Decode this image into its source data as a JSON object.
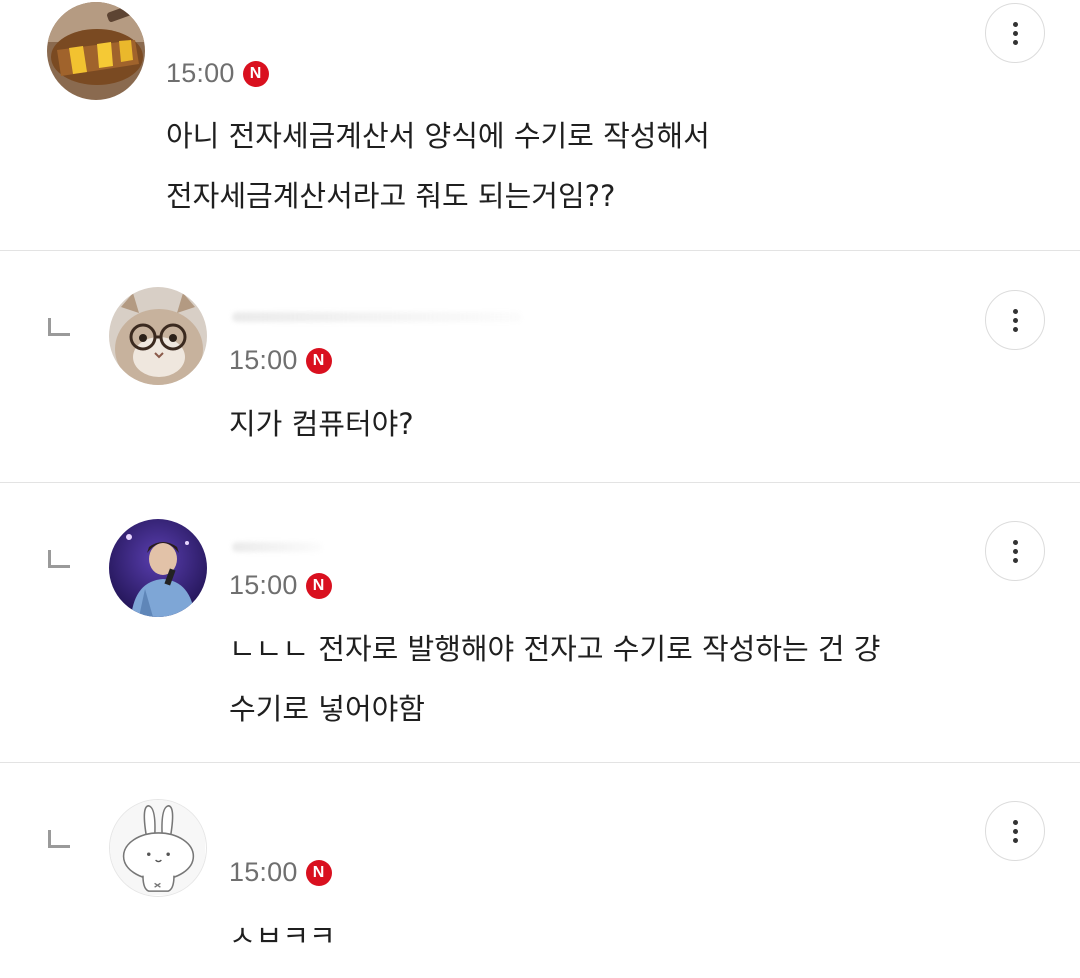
{
  "comments": [
    {
      "time": "15:00",
      "badge": "N",
      "lines": [
        "아니 전자세금계산서 양식에 수기로 작성해서",
        "전자세금계산서라고 줘도 되는거임??"
      ],
      "avatar_icon": "food-photo-avatar",
      "is_reply": false
    },
    {
      "time": "15:00",
      "badge": "N",
      "lines": [
        "지가 컴퓨터야?"
      ],
      "avatar_icon": "cat-with-glasses-avatar",
      "is_reply": true
    },
    {
      "time": "15:00",
      "badge": "N",
      "lines": [
        "ㄴㄴㄴ 전자로 발행해야 전자고 수기로 작성하는 건 걍",
        "수기로 넣어야함"
      ],
      "avatar_icon": "singer-on-stage-avatar",
      "is_reply": true
    },
    {
      "time": "15:00",
      "badge": "N",
      "lines": [
        "ㅅㅂㅋㅋ"
      ],
      "avatar_icon": "bunny-drawing-avatar",
      "is_reply": true
    }
  ],
  "colors": {
    "badge": "#d9101f",
    "time": "#6f6f6f",
    "divider": "#e3e3e3"
  }
}
